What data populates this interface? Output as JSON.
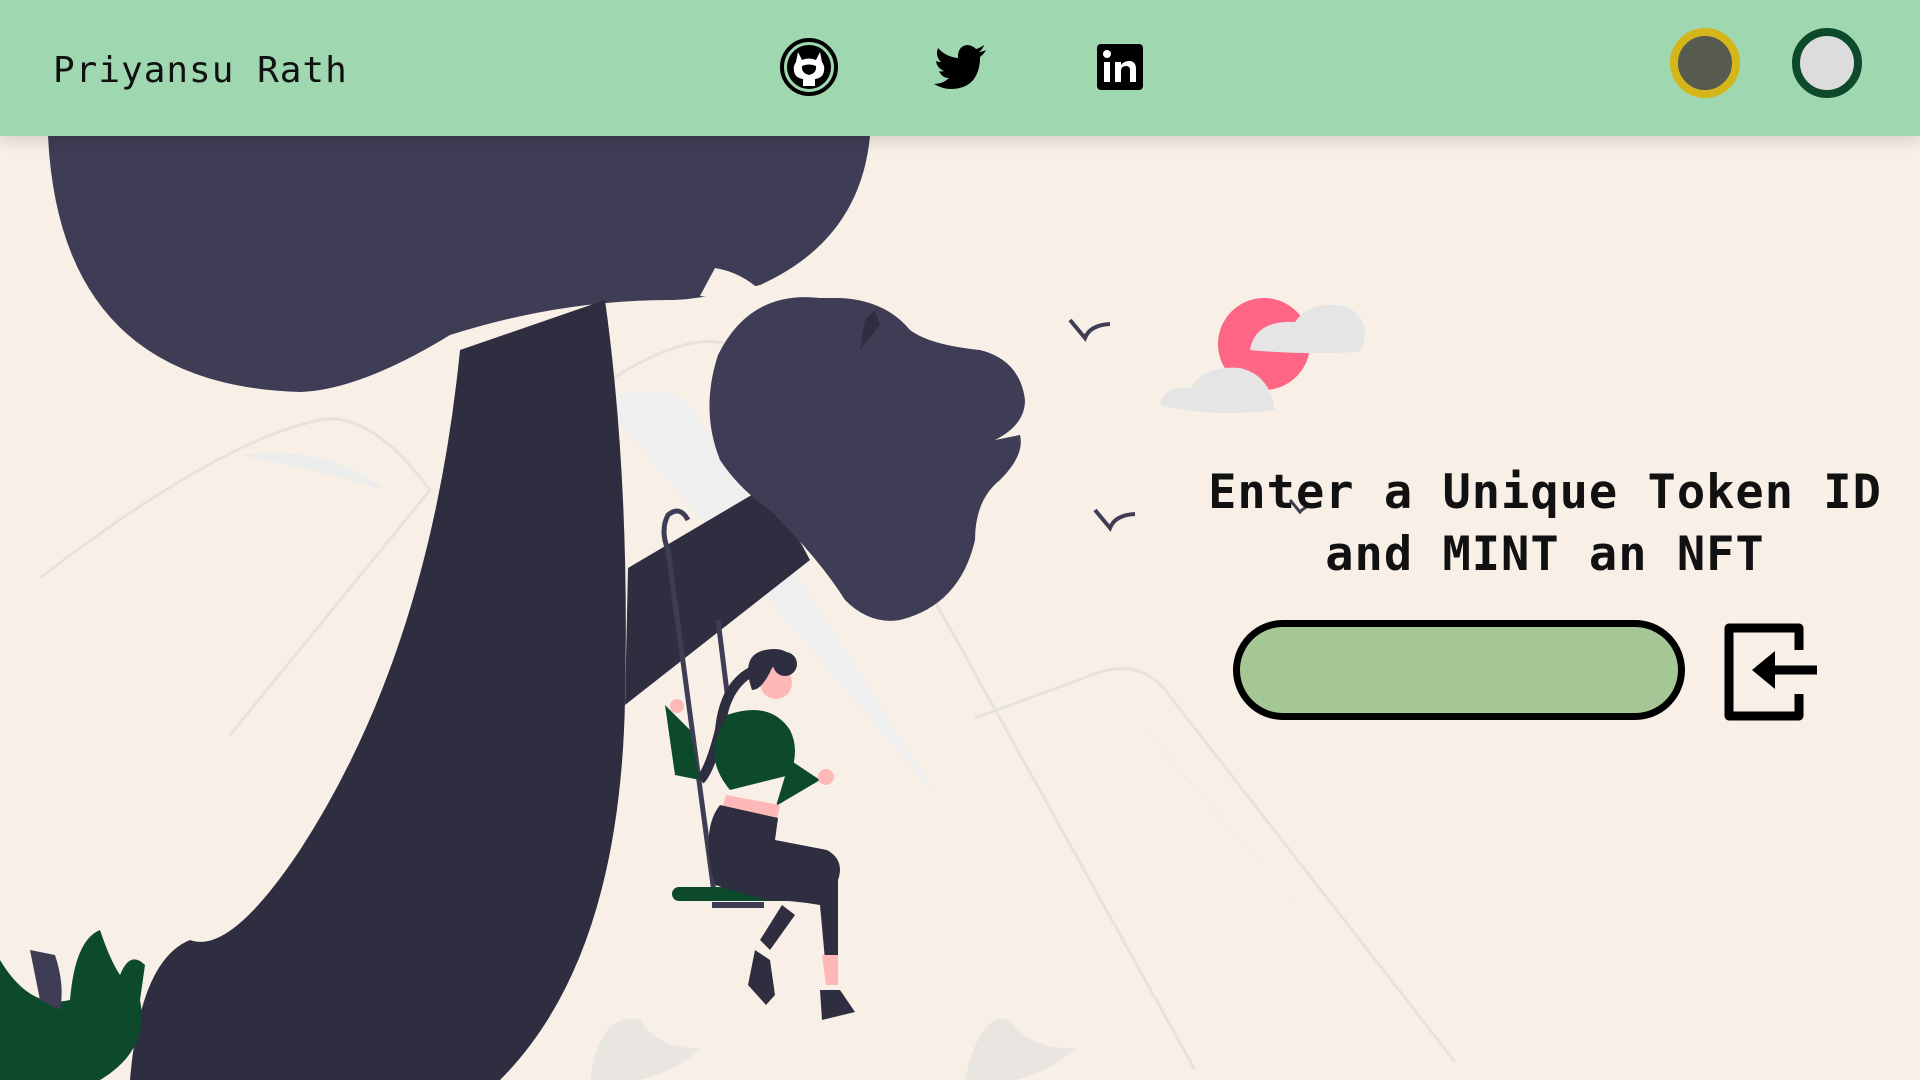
{
  "header": {
    "brand": "Priyansu Rath",
    "social_links": [
      {
        "icon": "github-icon"
      },
      {
        "icon": "twitter-icon"
      },
      {
        "icon": "linkedin-icon"
      }
    ],
    "theme_toggles": [
      {
        "name": "dark-theme-toggle",
        "color": "#575a4f",
        "ring": "#d4b51a"
      },
      {
        "name": "light-theme-toggle",
        "color": "#dcdcdc",
        "ring": "#0c4a2b"
      }
    ]
  },
  "mint": {
    "heading_line1": "Enter a Unique Token ID",
    "heading_line2": "and MINT an NFT",
    "input_value": "",
    "submit_icon": "login-arrow-icon"
  },
  "colors": {
    "header_bg": "#9fd8b0",
    "page_bg": "#f8f0e6",
    "input_bg": "#a5c796",
    "tree": "#2f2e41",
    "foliage": "#3f3d56",
    "accent_green": "#0c4a2b",
    "sun": "#ff6584"
  }
}
